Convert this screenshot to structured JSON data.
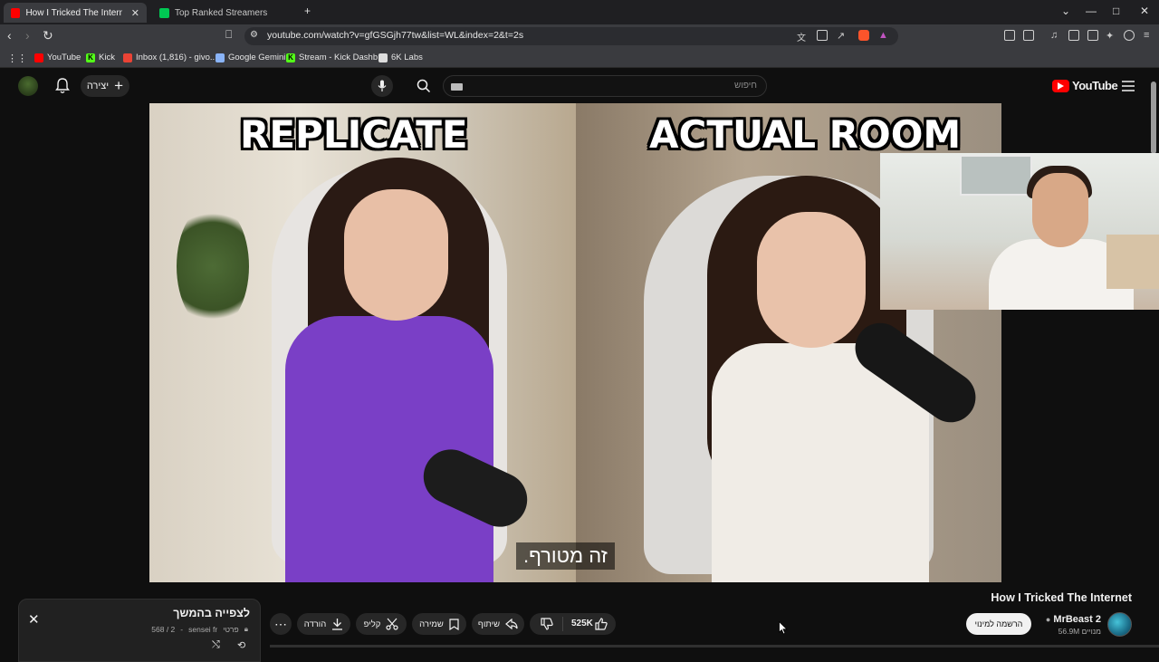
{
  "browser": {
    "tabs": [
      {
        "label": "How I Tricked The Internet - Y",
        "favicon_color": "#ff0000",
        "active": true
      },
      {
        "label": "Top Ranked Streamers",
        "favicon_color": "#00c853",
        "active": false
      }
    ],
    "new_tab": "+",
    "url": "youtube.com/watch?v=gfGSGjh77tw&list=WL&index=2&t=2s",
    "window_controls": {
      "minimize": "—",
      "maximize": "□",
      "close": "✕",
      "dropdown": "⌄"
    }
  },
  "bookmarks": [
    {
      "label": "YouTube",
      "icon": "youtube-icon",
      "color": "#ff0000"
    },
    {
      "label": "Kick",
      "icon": "kick-icon",
      "color": "#53fc18"
    },
    {
      "label": "Inbox (1,816) - givo...",
      "icon": "gmail-icon",
      "color": "#ea4335"
    },
    {
      "label": "Google Gemini",
      "icon": "gemini-icon",
      "color": "#8ab4f8"
    },
    {
      "label": "Stream - Kick Dashb...",
      "icon": "kick-icon",
      "color": "#53fc18"
    },
    {
      "label": "6K Labs",
      "icon": "labs-icon",
      "color": "#ffffff"
    }
  ],
  "youtube": {
    "logo_text": "YouTube",
    "create_label": "יצירה",
    "search_placeholder": "חיפוש"
  },
  "video": {
    "caption_left": "REPLICATE",
    "caption_right": "ACTUAL ROOM",
    "subtitle": "זה מטורף."
  },
  "details": {
    "title": "How I Tricked The Internet",
    "channel": "MrBeast 2",
    "subscribers": "56.9M מנויים",
    "subscribe_label": "הרשמה למינוי",
    "like_count": "525K",
    "share_label": "שיתוף",
    "save_label": "שמירה",
    "clip_label": "קליפ",
    "download_label": "הורדה"
  },
  "playlist": {
    "title": "לצפייה בהמשך",
    "owner": "sensei fr",
    "privacy": "פרטי",
    "position": "568 / 2"
  },
  "colors": {
    "background": "#0f0f0f",
    "brand_red": "#ff0000",
    "pill_bg": "#272727"
  }
}
